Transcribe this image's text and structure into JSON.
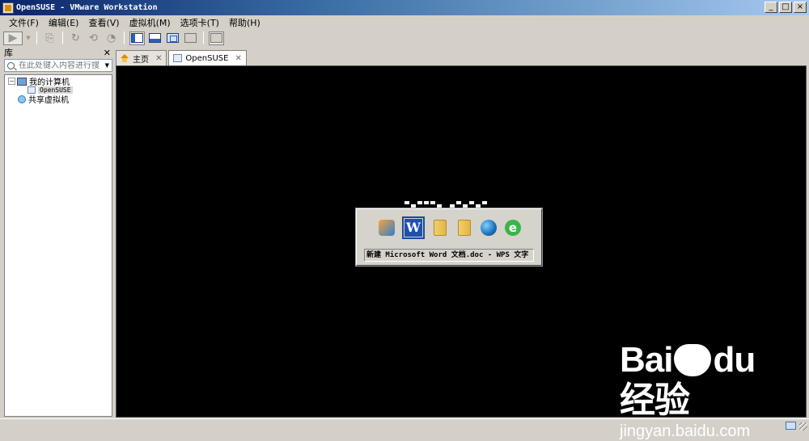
{
  "window": {
    "title": "OpenSUSE - VMware Workstation"
  },
  "menu": [
    "文件(F)",
    "编辑(E)",
    "查看(V)",
    "虚拟机(M)",
    "选项卡(T)",
    "帮助(H)"
  ],
  "library": {
    "title": "库",
    "search_placeholder": "在此处键入内容进行搜索",
    "my_computer": "我的计算机",
    "vm_name": "OpenSUSE",
    "shared_vms": "共享虚拟机"
  },
  "tabs": [
    {
      "label": "主页"
    },
    {
      "label": "OpenSUSE"
    }
  ],
  "switcher": {
    "caption": "新建 Microsoft Word 文档.doc - WPS 文字",
    "apps": [
      "qq-icon",
      "wps-writer-icon",
      "folder-icon",
      "folder-icon",
      "network-globe-icon",
      "browser-e-icon"
    ]
  },
  "watermark": {
    "logo_left": "Bai",
    "logo_mid": "du",
    "logo_cn": "经验",
    "url": "jingyan.baidu.com"
  }
}
